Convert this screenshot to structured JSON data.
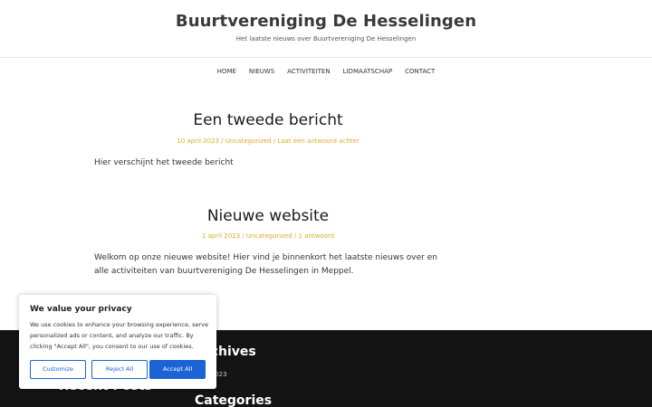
{
  "header": {
    "title": "Buurtvereniging De Hesselingen",
    "tagline": "Het laatste nieuws over Buurtvereniging De Hesselingen"
  },
  "nav": [
    "HOME",
    "NIEUWS",
    "ACTIVITEITEN",
    "LIDMAATSCHAP",
    "CONTACT"
  ],
  "posts": [
    {
      "title": "Een tweede bericht",
      "date": "10 april 2023",
      "category": "Uncategorized",
      "comments": "Laat een antwoord achter",
      "body": "Hier verschijnt het tweede bericht"
    },
    {
      "title": "Nieuwe website",
      "date": "1 april 2023",
      "category": "Uncategorized",
      "comments": "1 antwoord",
      "body": "Welkom op onze nieuwe website! Hier vind je binnenkort het laatste nieuws over en alle activiteiten van buurtvereniging De Hesselingen in Meppel."
    }
  ],
  "footer": {
    "archives_title": "Archives",
    "archives_item": "april 2023",
    "recent_title": "Recent Posts",
    "categories_title": "Categories"
  },
  "cookie": {
    "title": "We value your privacy",
    "text": "We use cookies to enhance your browsing experience, serve personalized ads or content, and analyze our traffic. By clicking \"Accept All\", you consent to our use of cookies.",
    "customize": "Customize",
    "reject": "Reject All",
    "accept": "Accept All"
  },
  "colors": {
    "accent": "#e0a92d",
    "button": "#1c63d5",
    "footer_bg": "#141414"
  }
}
